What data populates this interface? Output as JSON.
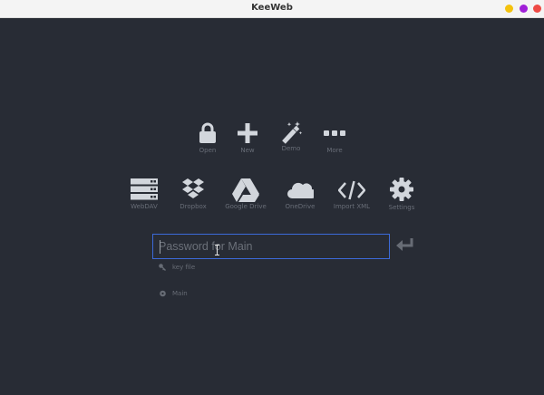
{
  "window": {
    "title": "KeeWeb",
    "controls": {
      "minimize_color": "#f4c20d",
      "maximize_color": "#a020d8",
      "close_color": "#ee4a45"
    }
  },
  "open_actions": [
    {
      "label": "Open",
      "icon": "lock-icon"
    },
    {
      "label": "New",
      "icon": "plus-icon"
    },
    {
      "label": "Demo",
      "icon": "magic-wand-icon"
    },
    {
      "label": "More",
      "icon": "ellipsis-icon"
    }
  ],
  "storage_actions": [
    {
      "label": "WebDAV",
      "icon": "server-icon"
    },
    {
      "label": "Dropbox",
      "icon": "dropbox-icon"
    },
    {
      "label": "Google Drive",
      "icon": "google-drive-icon"
    },
    {
      "label": "OneDrive",
      "icon": "cloud-icon"
    },
    {
      "label": "Import XML",
      "icon": "code-icon"
    },
    {
      "label": "Settings",
      "icon": "gear-icon"
    }
  ],
  "password": {
    "placeholder": "Password for Main",
    "value": ""
  },
  "key_file": {
    "label": "key file",
    "icon": "key-icon"
  },
  "last_file": {
    "label": "Main",
    "icon": "storage-icon"
  },
  "colors": {
    "background": "#282c35",
    "icon": "#d2d6dc",
    "accent": "#3c6ad9",
    "muted_text": "#686d77"
  }
}
